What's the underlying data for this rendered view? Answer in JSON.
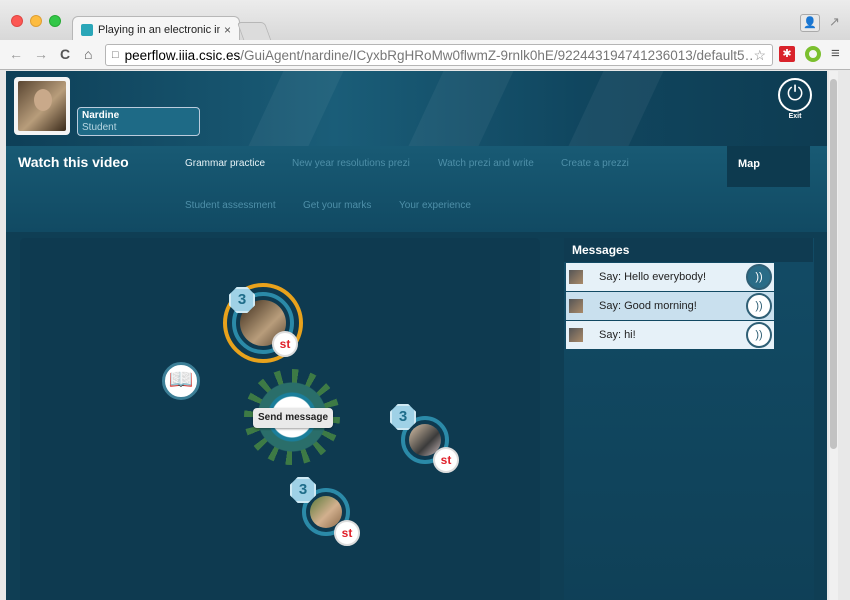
{
  "browser": {
    "tab_title": "Playing in an electronic ins",
    "tab_close": "×",
    "url_host": "peerflow.iiia.csic.es",
    "url_path": "/GuiAgent/nardine/ICyxbRgHRoMw0flwmZ-9rnlk0hE/922443194741236013/default5…"
  },
  "user": {
    "name": "Nardine",
    "role": "Student"
  },
  "exit": {
    "label": "Exit"
  },
  "page": {
    "section_title": "Watch this video",
    "menu": [
      "Grammar practice",
      "New year resolutions prezi",
      "Watch prezi and write",
      "Create a prezzi",
      "Student assessment",
      "Get your marks",
      "Your experience"
    ],
    "map_tab": "Map"
  },
  "map": {
    "send_message": "Send message",
    "nodes": [
      {
        "count": "3",
        "tag": "st"
      },
      {
        "count": "3",
        "tag": "st"
      },
      {
        "count": "3",
        "tag": "st"
      }
    ]
  },
  "messages": {
    "header": "Messages",
    "items": [
      {
        "text": "Say: Hello everybody!"
      },
      {
        "text": "Say: Good morning!"
      },
      {
        "text": "Say: hi!"
      }
    ]
  },
  "colors": {
    "accent_orange": "#e8a21c",
    "st_red": "#e0202a",
    "page_bg": "#0f3e54"
  },
  "icons": [
    "back-icon",
    "forward-icon",
    "reload-icon",
    "home-icon",
    "star-icon",
    "power-icon",
    "book-icon",
    "listen-icon",
    "menu-icon"
  ]
}
